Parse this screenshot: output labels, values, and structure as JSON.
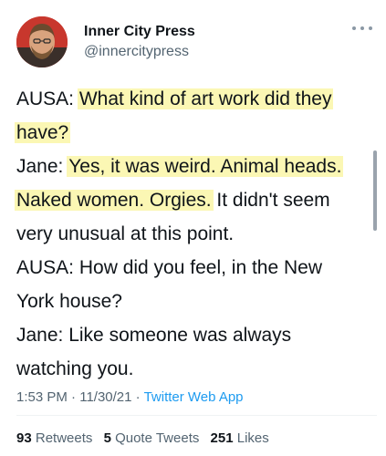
{
  "user": {
    "name": "Inner City Press",
    "handle": "@innercitypress"
  },
  "tweet": {
    "lines": [
      {
        "parts": [
          {
            "text": "AUSA: ",
            "hl": false
          },
          {
            "text": "What kind of art work did they",
            "hl": true
          }
        ]
      },
      {
        "parts": [
          {
            "text": "have?",
            "hl": true
          }
        ]
      },
      {
        "parts": [
          {
            "text": "Jane: ",
            "hl": false
          },
          {
            "text": "Yes, it was weird. Animal heads.",
            "hl": true
          }
        ]
      },
      {
        "parts": [
          {
            "text": "Naked women. Orgies.",
            "hl": true
          },
          {
            "text": " It didn't seem",
            "hl": false
          }
        ]
      },
      {
        "parts": [
          {
            "text": "very unusual at this point.",
            "hl": false
          }
        ]
      },
      {
        "parts": [
          {
            "text": "AUSA: How did you feel, in the New",
            "hl": false
          }
        ]
      },
      {
        "parts": [
          {
            "text": "York house?",
            "hl": false
          }
        ]
      },
      {
        "parts": [
          {
            "text": "Jane: Like someone was always",
            "hl": false
          }
        ]
      },
      {
        "parts": [
          {
            "text": "watching you.",
            "hl": false
          }
        ]
      }
    ],
    "highlight_color": "#fbf7b4"
  },
  "meta": {
    "time": "1:53 PM",
    "date": "11/30/21",
    "separator": "·",
    "app": "Twitter Web App"
  },
  "stats": {
    "retweets_count": "93",
    "retweets_label": "Retweets",
    "quotes_count": "5",
    "quotes_label": "Quote Tweets",
    "likes_count": "251",
    "likes_label": "Likes"
  },
  "icons": {
    "more": "more-horizontal-icon",
    "avatar": "profile-photo"
  },
  "colors": {
    "link": "#1d9bf0",
    "secondary_text": "#536471",
    "primary_text": "#0f1419"
  }
}
